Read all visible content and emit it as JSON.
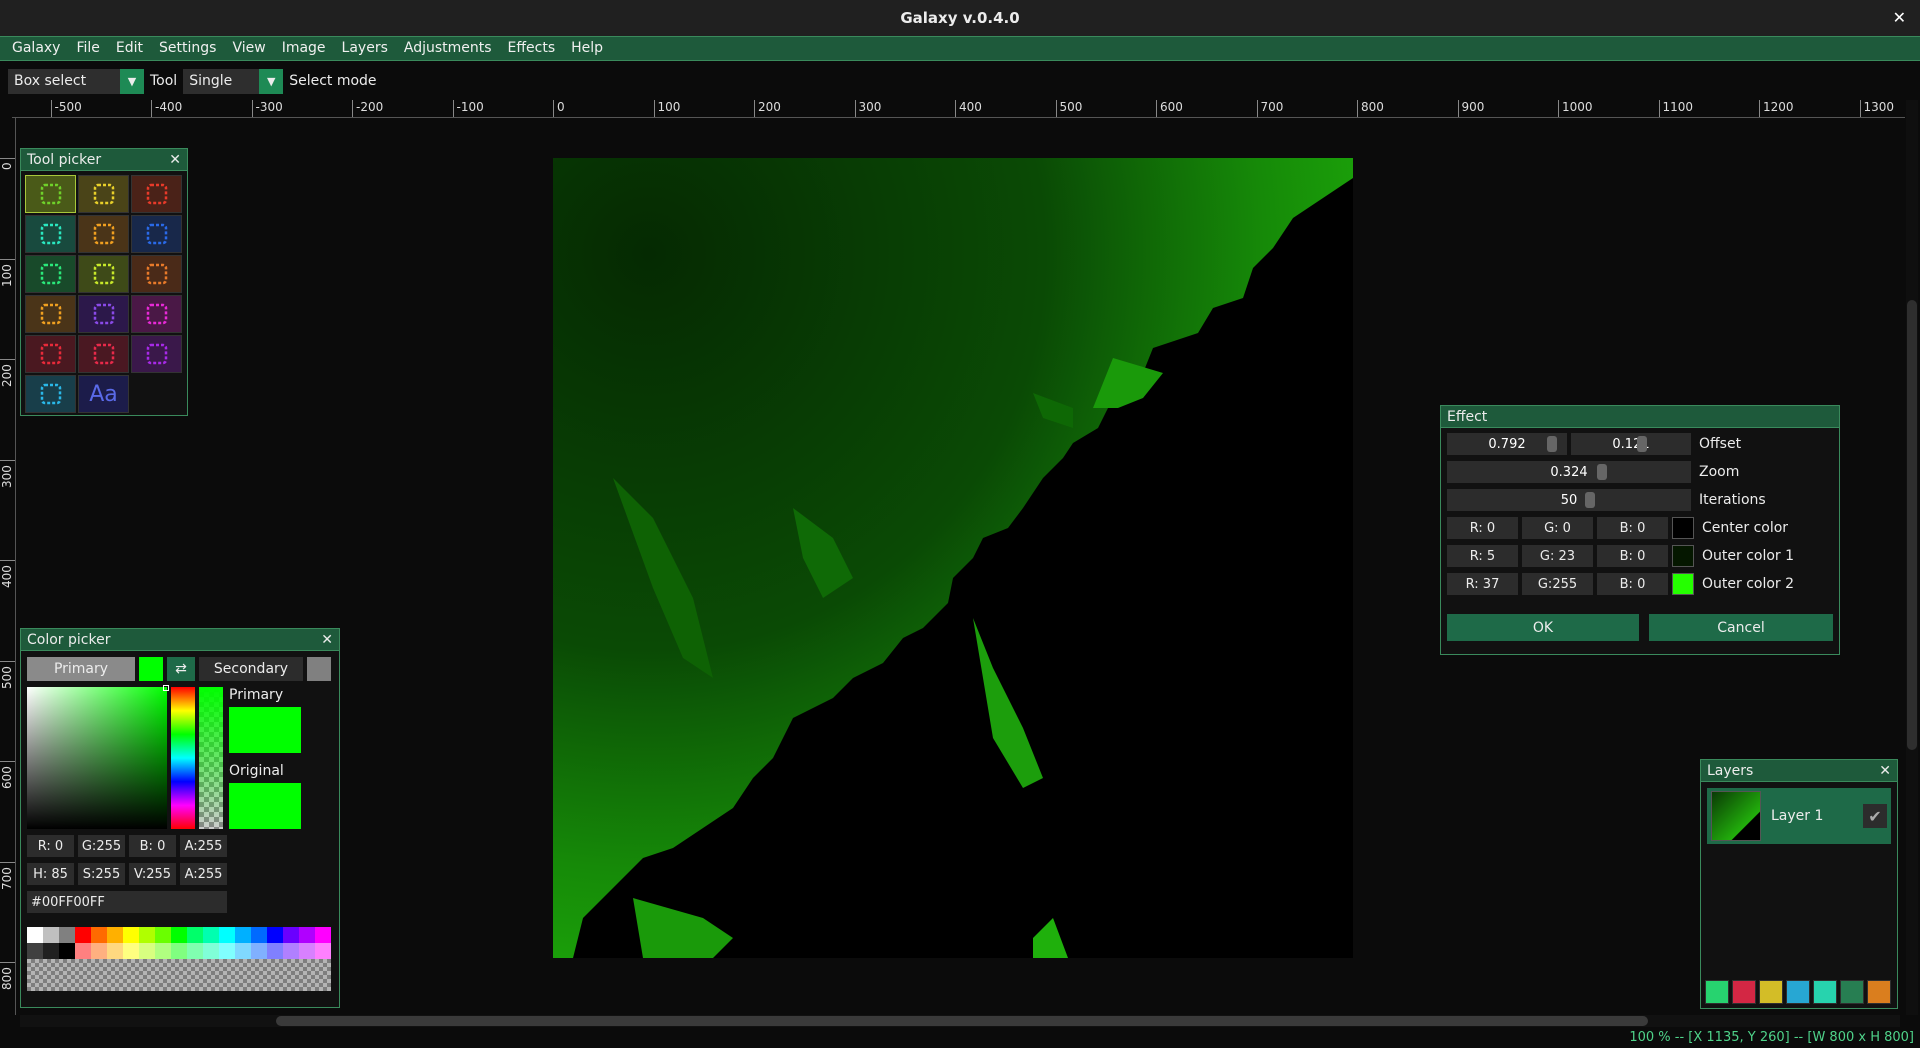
{
  "title": "Galaxy v.0.4.0",
  "menu": [
    "Galaxy",
    "File",
    "Edit",
    "Settings",
    "View",
    "Image",
    "Layers",
    "Adjustments",
    "Effects",
    "Help"
  ],
  "toolbar": {
    "tool_value": "Box select",
    "tool_label": "Tool",
    "mode_value": "Single",
    "mode_label": "Select mode"
  },
  "ruler_top_labels": [
    "-500",
    "-400",
    "-300",
    "-200",
    "-100",
    "0",
    "100",
    "200",
    "300",
    "400",
    "500",
    "600",
    "700",
    "800",
    "900",
    "1000",
    "1100",
    "1200",
    "1300"
  ],
  "ruler_left_labels": [
    "0",
    "100",
    "200",
    "300",
    "400",
    "500",
    "600",
    "700",
    "800"
  ],
  "tool_picker": {
    "title": "Tool picker",
    "tools": [
      {
        "name": "box-select-icon",
        "color": "#6fd12a",
        "bg": "#4a5a18"
      },
      {
        "name": "ellipse-select-icon",
        "color": "#e8d02a",
        "bg": "#4a4418"
      },
      {
        "name": "lasso-select-icon",
        "color": "#e83a2a",
        "bg": "#4a2218"
      },
      {
        "name": "magnifier-icon",
        "color": "#2ae8c0",
        "bg": "#184a3e"
      },
      {
        "name": "hand-pan-icon",
        "color": "#f0a020",
        "bg": "#4a3418"
      },
      {
        "name": "eyedropper-icon",
        "color": "#2a6ae8",
        "bg": "#18284a"
      },
      {
        "name": "move-icon",
        "color": "#2ae87a",
        "bg": "#184a2a"
      },
      {
        "name": "move-selection-icon",
        "color": "#c8e82a",
        "bg": "#3e4a18"
      },
      {
        "name": "magic-wand-icon",
        "color": "#e87a2a",
        "bg": "#4a2a18"
      },
      {
        "name": "pencil-icon",
        "color": "#f0a020",
        "bg": "#4a3418"
      },
      {
        "name": "brush-icon",
        "color": "#8a4ae8",
        "bg": "#2c184a"
      },
      {
        "name": "eraser-icon",
        "color": "#e82ad8",
        "bg": "#4a1846"
      },
      {
        "name": "paint-bucket-icon",
        "color": "#e82a3a",
        "bg": "#4a1820"
      },
      {
        "name": "gradient-icon",
        "color": "#e82a4a",
        "bg": "#4a1822"
      },
      {
        "name": "recolor-icon",
        "color": "#a82ae8",
        "bg": "#3a184a"
      },
      {
        "name": "shapes-icon",
        "color": "#2ab8e8",
        "bg": "#183e4a"
      },
      {
        "name": "text-icon",
        "color": "#5a6ae8",
        "bg": "#1c1c4a",
        "glyph": "Aa"
      }
    ]
  },
  "effect": {
    "title": "Effect",
    "offset_x": "0.792",
    "offset_y": "0.121",
    "offset_label": "Offset",
    "zoom": "0.324",
    "zoom_label": "Zoom",
    "iterations": "50",
    "iterations_label": "Iterations",
    "colors": [
      {
        "r": "R:  0",
        "g": "G:  0",
        "b": "B:  0",
        "hex": "#000000",
        "label": "Center color"
      },
      {
        "r": "R:  5",
        "g": "G: 23",
        "b": "B:  0",
        "hex": "#051700",
        "label": "Outer color 1"
      },
      {
        "r": "R: 37",
        "g": "G:255",
        "b": "B:  0",
        "hex": "#25ff00",
        "label": "Outer color 2"
      }
    ],
    "ok": "OK",
    "cancel": "Cancel"
  },
  "color_picker": {
    "title": "Color picker",
    "primary_btn": "Primary",
    "secondary_btn": "Secondary",
    "primary_color": "#00ff00",
    "secondary_color": "#808080",
    "primary_label": "Primary",
    "original_label": "Original",
    "r": "R:  0",
    "g": "G:255",
    "b": "B:  0",
    "a": "A:255",
    "h": "H: 85",
    "s": "S:255",
    "v": "V:255",
    "a2": "A:255",
    "hex": "#00FF00FF",
    "palette_row1": [
      "#ffffff",
      "#c0c0c0",
      "#808080",
      "#ff0000",
      "#ff6a00",
      "#ffb000",
      "#ffff00",
      "#b0ff00",
      "#6aff00",
      "#00ff00",
      "#00ff6a",
      "#00ffb0",
      "#00ffff",
      "#00b0ff",
      "#006aff",
      "#0000ff",
      "#6a00ff",
      "#b000ff",
      "#ff00ff"
    ],
    "palette_row2": [
      "#404040",
      "#202020",
      "#000000",
      "#ff8080",
      "#ffb080",
      "#ffd880",
      "#ffff80",
      "#d8ff80",
      "#b0ff80",
      "#80ff80",
      "#80ffb0",
      "#80ffd8",
      "#80ffff",
      "#80d8ff",
      "#80b0ff",
      "#8080ff",
      "#b080ff",
      "#d880ff",
      "#ff80ff"
    ]
  },
  "layers": {
    "title": "Layers",
    "items": [
      {
        "name": "Layer 1",
        "visible": true
      }
    ],
    "actions": [
      {
        "name": "add-layer-icon",
        "color": "#2ae87a"
      },
      {
        "name": "delete-layer-icon",
        "color": "#e82a4a"
      },
      {
        "name": "duplicate-layer-icon",
        "color": "#e8d02a"
      },
      {
        "name": "move-layer-up-icon",
        "color": "#2ab8e8"
      },
      {
        "name": "move-layer-down-icon",
        "color": "#2ae8c0"
      },
      {
        "name": "merge-layer-icon",
        "color": "#2a8a5a"
      },
      {
        "name": "layer-properties-icon",
        "color": "#f08a20"
      }
    ]
  },
  "status": "100 % -- [X 1135, Y 260] -- [W 800 x H 800]"
}
